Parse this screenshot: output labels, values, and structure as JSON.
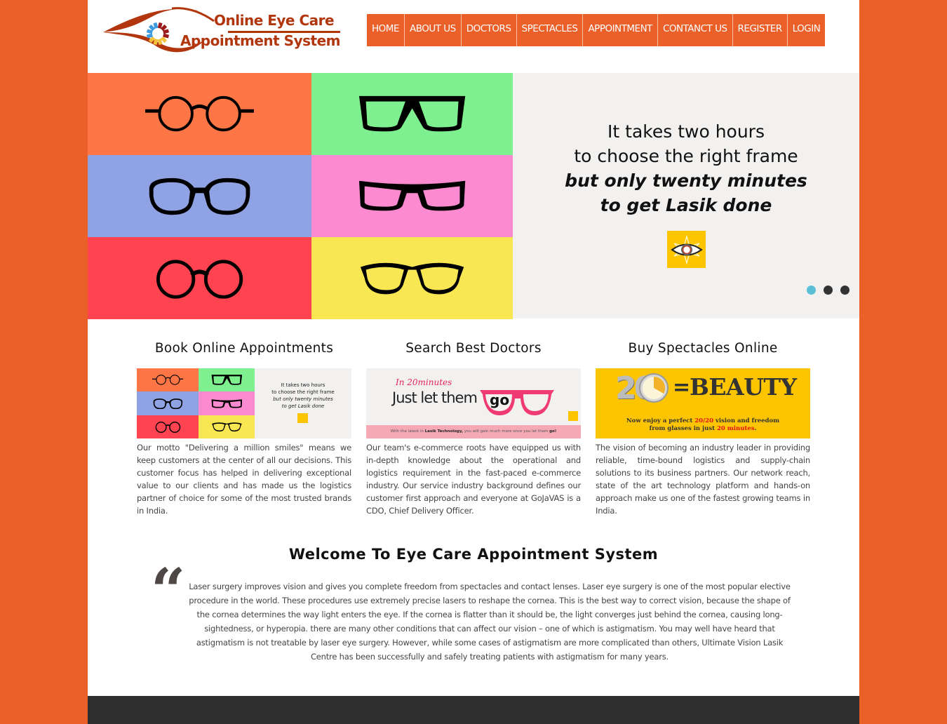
{
  "logo": {
    "line1": "Online Eye Care",
    "line2": "Appointment System",
    "colors": {
      "brand": "#b2360d"
    }
  },
  "nav": {
    "items": [
      {
        "label": "HOME"
      },
      {
        "label": "ABOUT US"
      },
      {
        "label": "DOCTORS"
      },
      {
        "label": "SPECTACLES"
      },
      {
        "label": "APPOINTMENT"
      },
      {
        "label": "CONTANCT US"
      },
      {
        "label": "REGISTER"
      },
      {
        "label": "LOGIN"
      }
    ],
    "color": "#eb5f28"
  },
  "slider": {
    "tiles": [
      {
        "color": "#ff7646",
        "style": "round"
      },
      {
        "color": "#7ff08f",
        "style": "aviator-square"
      },
      {
        "color": "#8fa3e4",
        "style": "large-square"
      },
      {
        "color": "#fb8ad0",
        "style": "narrow-rect"
      },
      {
        "color": "#ff4350",
        "style": "round-bold"
      },
      {
        "color": "#f8e652",
        "style": "wayfarer"
      }
    ],
    "quote_line1": "It takes two hours",
    "quote_line2": "to choose the right frame",
    "quote_line3": "but only twenty minutes",
    "quote_line4": "to get Lasik done",
    "badge_icon": "eye-star-icon",
    "dots": [
      {
        "active": true
      },
      {
        "active": false
      },
      {
        "active": false
      }
    ]
  },
  "features": [
    {
      "title": "Book Online Appointments",
      "thumb": {
        "line1": "It takes two hours",
        "line2": "to choose the right frame",
        "line3": "but only twenty minutes",
        "line4": "to get Lasik done"
      },
      "text": "Our motto \"Delivering a million smiles\" means we keep customers at the center of all our decisions. This customer focus has helped in delivering exceptional value to our clients and has made us the logistics partner of choice for some of the most trusted brands in India."
    },
    {
      "title": "Search Best Doctors",
      "thumb": {
        "script": "In 20minutes",
        "headline": "Just let them",
        "go": "go",
        "footer_pre": "With the latest in ",
        "footer_bold": "Lasik Technology,",
        "footer_mid": " you will gain much more once you let them ",
        "footer_end": "go!"
      },
      "text": "Our team's e-commerce roots have equipped us with in-depth knowledge about the operational and logistics requirement in the fast-paced e-commerce industry. Our service industry background defines our customer first approach and everyone at GoJaVAS is a CDO, Chief Delivery Officer."
    },
    {
      "title": "Buy Spectacles Online",
      "thumb": {
        "number": "20",
        "equals": "=",
        "word": "BEAUTY",
        "line1_pre": "Now enjoy a perfect ",
        "line1_hl": "20/20",
        "line1_post": " vision and freedom",
        "line2_pre": "from glasses in just ",
        "line2_hl": "20 minutes",
        "line2_post": "."
      },
      "text": "The vision of becoming an industry leader in providing reliable, time-bound logistics and supply-chain solutions to its business partners. Our network reach, state of the art technology platform and hands-on approach make us one of the fastest growing teams in India."
    }
  ],
  "welcome": {
    "title": "Welcome To Eye Care Appointment System",
    "quote_mark": "“",
    "text": "Laser surgery improves vision and gives you complete freedom from spectacles and contact lenses. Laser eye surgery is one of the most popular elective procedure in the world. These procedures use extremely precise lasers to reshape the cornea. This is the best way to correct vision, because the shape of the cornea determines the way light enters the eye. If the cornea is flatter than it should be, the light converges just behind the cornea, causing long-sightedness, or hyperopia. there are many other conditions that can affect our vision – one of which is astigmatism. You may well have heard that astigmatism is not treatable by laser eye surgery. However, while some cases of astigmatism are more complicated than others, Ultimate Vision Lasik Centre has been successfully and safely treating patients with astigmatism for many years."
  }
}
